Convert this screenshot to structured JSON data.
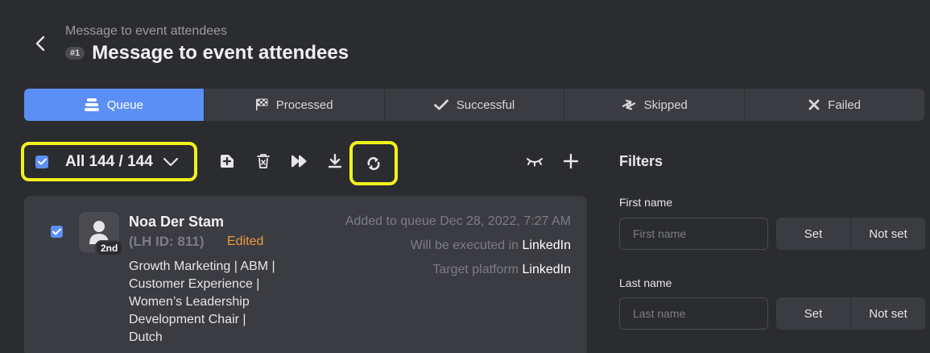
{
  "header": {
    "subtitle": "Message to event attendees",
    "badge": "#1",
    "title": "Message to event attendees"
  },
  "tabs": [
    {
      "label": "Queue",
      "icon": "stack-icon",
      "active": true
    },
    {
      "label": "Processed",
      "icon": "checkered-flag-icon",
      "active": false
    },
    {
      "label": "Successful",
      "icon": "check-icon",
      "active": false
    },
    {
      "label": "Skipped",
      "icon": "swap-arrows-icon",
      "active": false
    },
    {
      "label": "Failed",
      "icon": "x-icon",
      "active": false
    }
  ],
  "toolbar": {
    "select_label": "All 144 / 144",
    "actions": [
      "add-icon",
      "trash-icon",
      "fast-forward-icon",
      "download-icon",
      "refresh-icon"
    ],
    "view_actions": [
      "eye-closed-icon",
      "plus-icon"
    ]
  },
  "item": {
    "name": "Noa Der Stam",
    "lh_id": "(LH ID: 811)",
    "edited": "Edited",
    "degree": "2nd",
    "headline_lines": [
      "Growth Marketing | ABM |",
      "Customer Experience |",
      "Women’s Leadership",
      "Development Chair |",
      "Dutch"
    ],
    "added": "Added to queue Dec 28, 2022, 7:27 AM",
    "executed_label": "Will be executed in",
    "executed_value": "LinkedIn",
    "platform_label": "Target platform",
    "platform_value": "LinkedIn"
  },
  "filters": {
    "title": "Filters",
    "fields": [
      {
        "label": "First name",
        "placeholder": "First name",
        "set": "Set",
        "not_set": "Not set"
      },
      {
        "label": "Last name",
        "placeholder": "Last name",
        "set": "Set",
        "not_set": "Not set"
      }
    ]
  },
  "colors": {
    "background": "#2b2c30",
    "accent": "#5b8ff5",
    "highlight": "#f2f21c",
    "edited": "#e89a42"
  }
}
